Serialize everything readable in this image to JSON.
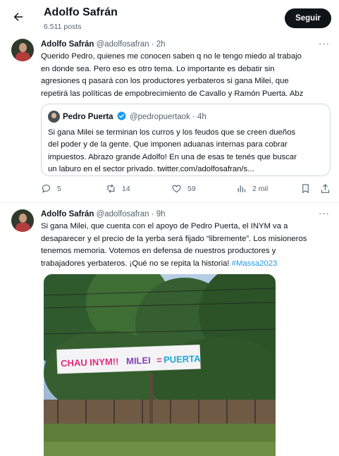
{
  "header": {
    "title": "Adolfo Safrán",
    "posts_count": "6.511 posts",
    "follow_label": "Seguir"
  },
  "tweet1": {
    "name": "Adolfo Safrán",
    "handle_time": "@adolfosafran · 2h",
    "lines": [
      "Querido Pedro, quienes me conocen saben q no le tengo miedo al trabajo",
      "en donde sea. Pero eso es otro tema. Lo importante es debatir sin",
      "agresiones q pasará con los productores yerbateros si gana Milei, que",
      "repetirá las políticas de empobrecimiento de Cavallo y Ramón Puerta. Abz"
    ],
    "quote": {
      "name": "Pedro Puerta",
      "handle_time": "@pedropuertaok · 4h",
      "lines": [
        "Si gana Milei se terminan los curros y los feudos que se creen dueños",
        "del poder y de la gente. Que imponen aduanas internas para cobrar",
        "impuestos. Abrazo grande Adolfo! En una de esas te tenés que buscar",
        "un laburo en el sector privado. twitter.com/adolfosafran/s..."
      ]
    },
    "replies": "5",
    "retweets": "14",
    "likes": "59",
    "views": "2 mil"
  },
  "tweet2": {
    "name": "Adolfo Safrán",
    "handle_time": "@adolfosafran · 9h",
    "lines": [
      "Si gana Milei, que cuenta con el apoyo de Pedro Puerta, el INYM va a",
      "desaparecer y el precio de la yerba será fijado “libremente”. Los misioneros",
      "tenemos memoria. Votemos en defensa de nuestros productores y",
      "trabajadores yerbateros. ¡Qué no se repita la historia!"
    ],
    "hashtag": "#Massa2023",
    "banner_text": {
      "left": "CHAU INYM!!",
      "milei": "MILEI",
      "eq": "=",
      "puerta": "PUERTA"
    }
  },
  "colors": {
    "accent": "#1d9bf0",
    "text": "#0f1419",
    "secondary": "#536471",
    "border": "#cfd9de",
    "follow_bg": "#0f1419"
  }
}
